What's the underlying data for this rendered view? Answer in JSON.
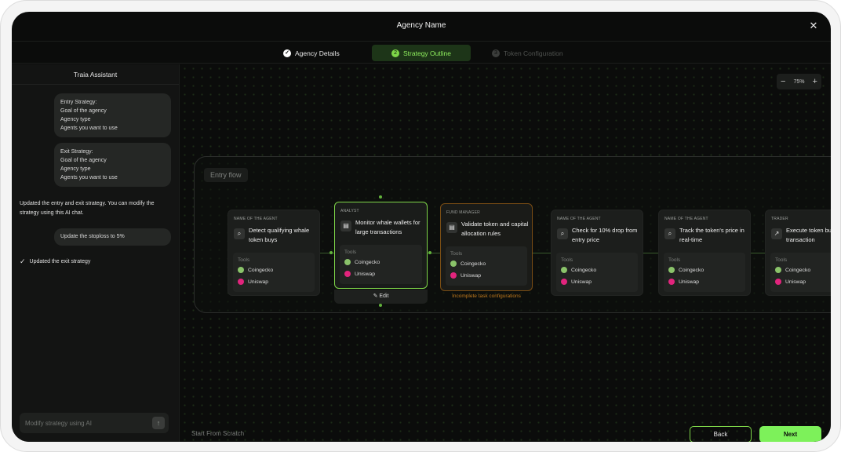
{
  "window": {
    "title": "Agency Name",
    "close_icon": "close-icon"
  },
  "steps": [
    {
      "label": "Agency Details",
      "marker": "✓",
      "state": "completed"
    },
    {
      "label": "Strategy Outline",
      "marker": "2",
      "state": "active"
    },
    {
      "label": "Token Configuration",
      "marker": "3",
      "state": "upcoming"
    }
  ],
  "sidebar": {
    "title": "Traia Assistant",
    "messages": [
      {
        "lines": [
          "Entry Strategy:",
          "Goal of the agency",
          "Agency type",
          "Agents you want to use"
        ]
      },
      {
        "lines": [
          "Exit Strategy:",
          "Goal of the agency",
          "Agency type",
          "Agents you want to use"
        ]
      }
    ],
    "assistant_reply": "Updated the entry and exit strategy. You can modify the strategy using this AI chat.",
    "user_message": "Update the stoploss to 5%",
    "status_line": "Updated the exit strategy",
    "input_placeholder": "Modify strategy using AI"
  },
  "canvas": {
    "zoom_level": "75%",
    "flow_label": "Entry flow",
    "tools_label": "Tools",
    "edit_label": "Edit",
    "warning": "Incomplete task configurations",
    "agents": [
      {
        "role": "NAME OF THE AGENT",
        "task": "Detect qualifying whale token buys",
        "icon": "search-icon",
        "tools": [
          "Coingecko",
          "Uniswap"
        ],
        "state": "normal"
      },
      {
        "role": "ANALYST",
        "task": "Monitor whale wallets for large transactions",
        "icon": "document-icon",
        "tools": [
          "Coingecko",
          "Uniswap"
        ],
        "state": "selected"
      },
      {
        "role": "FUND MANAGER",
        "task": "Validate token and capital allocation rules",
        "icon": "document-icon",
        "tools": [
          "Coingecko",
          "Uniswap"
        ],
        "state": "warning"
      },
      {
        "role": "NAME OF THE AGENT",
        "task": "Check for 10% drop from entry price",
        "icon": "search-icon",
        "tools": [
          "Coingecko",
          "Uniswap"
        ],
        "state": "normal"
      },
      {
        "role": "NAME OF THE AGENT",
        "task": "Track the token's price in real-time",
        "icon": "search-icon",
        "tools": [
          "Coingecko",
          "Uniswap"
        ],
        "state": "normal"
      },
      {
        "role": "TRADER",
        "task": "Execute token buy transaction",
        "icon": "chart-icon",
        "tools": [
          "Coingecko",
          "Uniswap"
        ],
        "state": "normal"
      }
    ]
  },
  "footer": {
    "scratch_label": "Start From Scratch",
    "back_label": "Back",
    "next_label": "Next"
  },
  "colors": {
    "accent": "#7ed648",
    "warning": "#c07a1d",
    "coingecko": "#8ac36a",
    "uniswap": "#e2247d"
  }
}
